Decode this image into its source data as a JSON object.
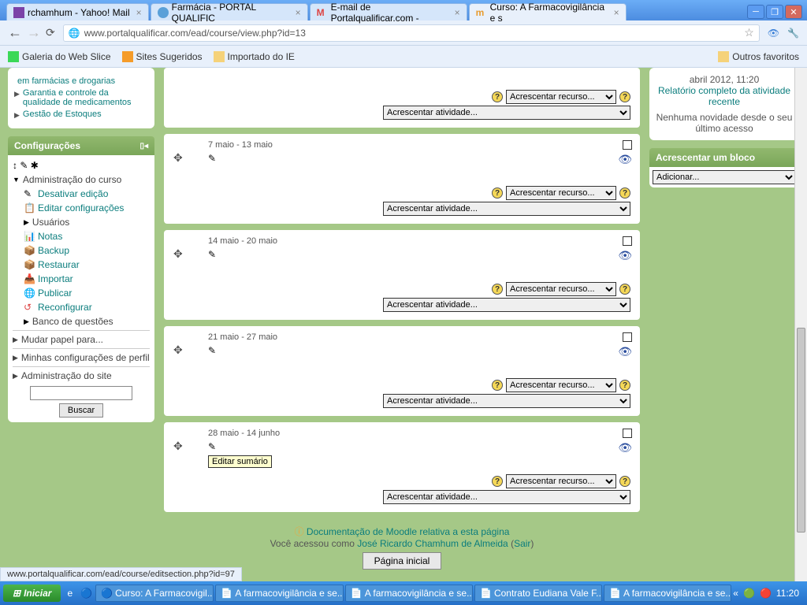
{
  "browser": {
    "tabs": [
      {
        "label": "rchamhum - Yahoo! Mail"
      },
      {
        "label": "Farmácia - PORTAL QUALIFIC"
      },
      {
        "label": "E-mail de Portalqualificar.com -"
      },
      {
        "label": "Curso: A Farmacovigilância e s"
      }
    ],
    "url": "www.portalqualificar.com/ead/course/view.php?id=13",
    "bookmarks": {
      "b1": "Galeria do Web Slice",
      "b2": "Sites Sugeridos",
      "b3": "Importado do IE",
      "other": "Outros favoritos"
    }
  },
  "sidebar_nav": {
    "item1": "em farmácias e drogarias",
    "item2": "Garantia e controle da qualidade de medicamentos",
    "item3": "Gestão de Estoques"
  },
  "config": {
    "title": "Configurações",
    "admin_header": "Administração do curso",
    "items": {
      "desativar": "Desativar edição",
      "editar": "Editar configurações",
      "usuarios": "Usuários",
      "notas": "Notas",
      "backup": "Backup",
      "restaurar": "Restaurar",
      "importar": "Importar",
      "publicar": "Publicar",
      "reconfigurar": "Reconfigurar",
      "banco": "Banco de questões"
    },
    "mudar": "Mudar papel para...",
    "perfil": "Minhas configurações de perfil",
    "site": "Administração do site",
    "buscar": "Buscar"
  },
  "sections": [
    {
      "date": ""
    },
    {
      "date": "7 maio - 13 maio"
    },
    {
      "date": "14 maio - 20 maio"
    },
    {
      "date": "21 maio - 27 maio"
    },
    {
      "date": "28 maio - 14 junho"
    }
  ],
  "dropdowns": {
    "recurso": "Acrescentar recurso...",
    "atividade": "Acrescentar atividade..."
  },
  "tooltip": "Editar sumário",
  "right": {
    "date": "abril 2012, 11:20",
    "report": "Relatório completo da atividade recente",
    "novelty": "Nenhuma novidade desde o seu último acesso",
    "add_block": "Acrescentar um bloco",
    "adicionar": "Adicionar..."
  },
  "footer": {
    "doc": "Documentação de Moodle relativa a esta página",
    "logged_pre": "Você acessou como ",
    "user": "José Ricardo Chamhum de Almeida",
    "sair": "Sair",
    "home": "Página inicial"
  },
  "statusbar": "www.portalqualificar.com/ead/course/editsection.php?id=97",
  "taskbar": {
    "start": "Iniciar",
    "items": [
      "Curso: A Farmacovigil...",
      "A farmacovigilância e se...",
      "A farmacovigilância e se...",
      "Contrato Eudiana Vale F...",
      "A farmacovigilância e se..."
    ],
    "clock": "11:20"
  }
}
